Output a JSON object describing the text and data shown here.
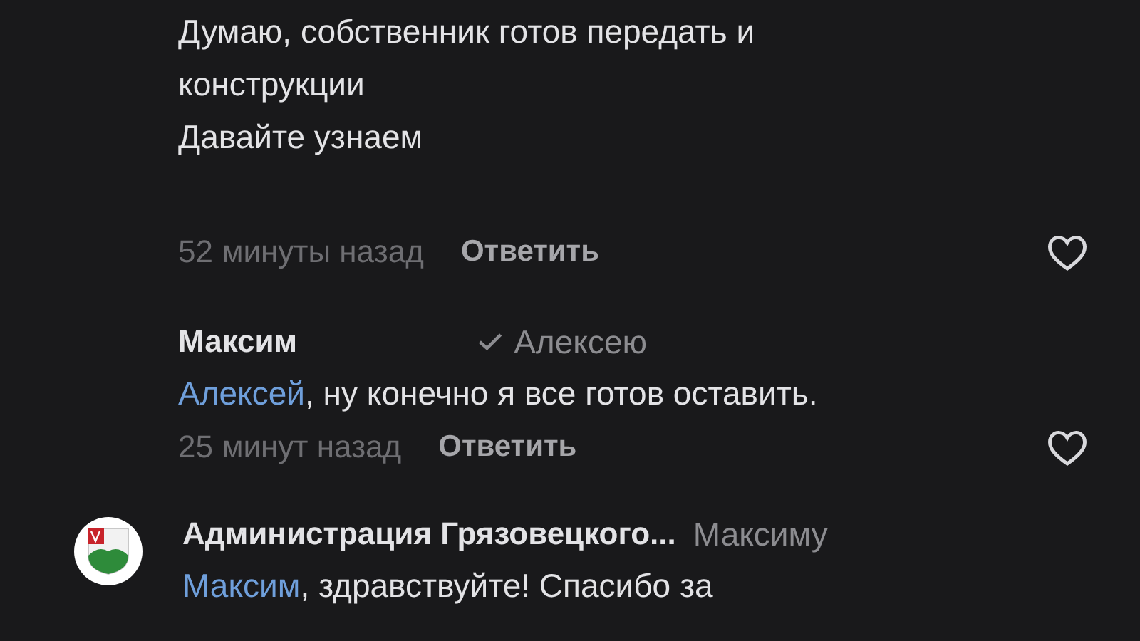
{
  "comments": [
    {
      "kind": "plain",
      "text_lines": [
        "Думаю, собственник готов передать и",
        "конструкции",
        "Давайте узнаем"
      ],
      "time": "52 минуты назад",
      "reply_label": "Ответить"
    },
    {
      "kind": "reply",
      "author": "Максим",
      "reply_to": "Алексею",
      "mention": "Алексей",
      "text": ", ну конечно я все готов оставить.",
      "time": "25 минут назад",
      "reply_label": "Ответить"
    },
    {
      "kind": "reply_avatar",
      "author": "Администрация Грязовецкого...",
      "reply_to": "Максиму",
      "mention": "Максим",
      "text": ", здравствуйте! Спасибо за"
    }
  ]
}
